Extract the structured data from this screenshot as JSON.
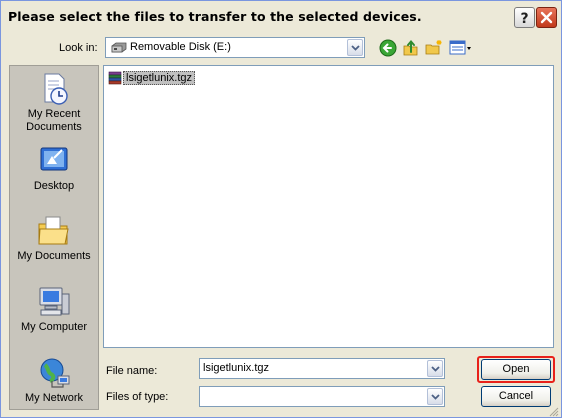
{
  "window": {
    "title": "Please select the files to transfer to the selected devices.",
    "help_icon": "question-mark-icon",
    "close_icon": "close-x-icon",
    "close_color": "#c1391b"
  },
  "toolbar": {
    "look_in_label": "Look in:",
    "look_in_value": "Removable Disk (E:)",
    "look_in_icon": "removable-disk-icon",
    "back_icon": "back-arrow-icon",
    "up_icon": "up-folder-icon",
    "new_folder_icon": "new-folder-icon",
    "views_icon": "views-menu-icon"
  },
  "places": [
    {
      "label_line1": "My Recent",
      "label_line2": "Documents",
      "icon": "recent-documents-icon"
    },
    {
      "label_line1": "Desktop",
      "label_line2": "",
      "icon": "desktop-icon"
    },
    {
      "label_line1": "My Documents",
      "label_line2": "",
      "icon": "my-documents-folder-icon"
    },
    {
      "label_line1": "My Computer",
      "label_line2": "",
      "icon": "my-computer-icon"
    },
    {
      "label_line1": "My Network",
      "label_line2": "",
      "icon": "my-network-icon"
    }
  ],
  "files": [
    {
      "name": "lsigetlunix.tgz",
      "icon": "archive-file-icon",
      "selected": true
    }
  ],
  "form": {
    "file_name_label": "File name:",
    "file_name_value": "lsigetlunix.tgz",
    "files_of_type_label": "Files of type:",
    "files_of_type_value": "",
    "open_label": "Open",
    "cancel_label": "Cancel",
    "highlight_color": "#e8211a"
  }
}
